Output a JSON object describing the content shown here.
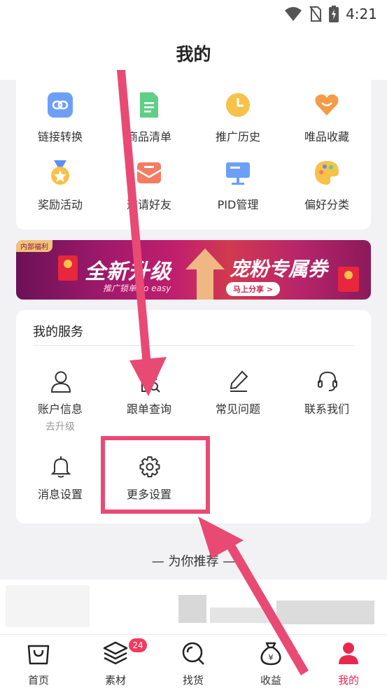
{
  "status_bar": {
    "time": "4:21",
    "icons": [
      "wifi-icon",
      "no-sim-icon",
      "battery-charging-icon"
    ]
  },
  "header": {
    "title": "我的"
  },
  "tools": [
    {
      "label": "链接转换",
      "icon": "link-convert-icon",
      "color": "#5b8ff9"
    },
    {
      "label": "商品清单",
      "icon": "product-list-icon",
      "color": "#4cc47a"
    },
    {
      "label": "推广历史",
      "icon": "promotion-history-icon",
      "color": "#f5b731"
    },
    {
      "label": "唯品收藏",
      "icon": "favorite-heart-icon",
      "color": "#f28a3c"
    },
    {
      "label": "奖励活动",
      "icon": "reward-medal-icon",
      "color": "#f5b731"
    },
    {
      "label": "邀请好友",
      "icon": "invite-envelope-icon",
      "color": "#f26b55"
    },
    {
      "label": "PID管理",
      "icon": "pid-board-icon",
      "color": "#5b8ff9"
    },
    {
      "label": "偏好分类",
      "icon": "palette-icon",
      "color": "#f5b731"
    }
  ],
  "banner": {
    "tag": "内部福利",
    "title_left": "全新升级",
    "title_right": "宠粉专属券",
    "subtitle": "推广锁单 so easy",
    "button": "马上分享 >"
  },
  "services": {
    "title": "我的服务",
    "items": [
      {
        "label": "账户信息",
        "sub": "去升级",
        "icon": "user-icon"
      },
      {
        "label": "跟单查询",
        "sub": "",
        "icon": "order-search-icon"
      },
      {
        "label": "常见问题",
        "sub": "",
        "icon": "edit-pen-icon"
      },
      {
        "label": "联系我们",
        "sub": "",
        "icon": "headset-icon"
      },
      {
        "label": "消息设置",
        "sub": "",
        "icon": "bell-icon"
      },
      {
        "label": "更多设置",
        "sub": "",
        "icon": "gear-icon"
      }
    ]
  },
  "recommend": {
    "title": "—  为你推荐  —"
  },
  "tabbar": {
    "items": [
      {
        "label": "首页",
        "icon": "shopping-bag-icon",
        "active": false
      },
      {
        "label": "素材",
        "icon": "layers-icon",
        "active": false,
        "badge": "24"
      },
      {
        "label": "找货",
        "icon": "search-icon",
        "active": false
      },
      {
        "label": "收益",
        "icon": "money-bag-icon",
        "active": false
      },
      {
        "label": "我的",
        "icon": "profile-icon",
        "active": true
      }
    ]
  },
  "colors": {
    "accent": "#e8294f",
    "annotation": "#e84a74"
  }
}
